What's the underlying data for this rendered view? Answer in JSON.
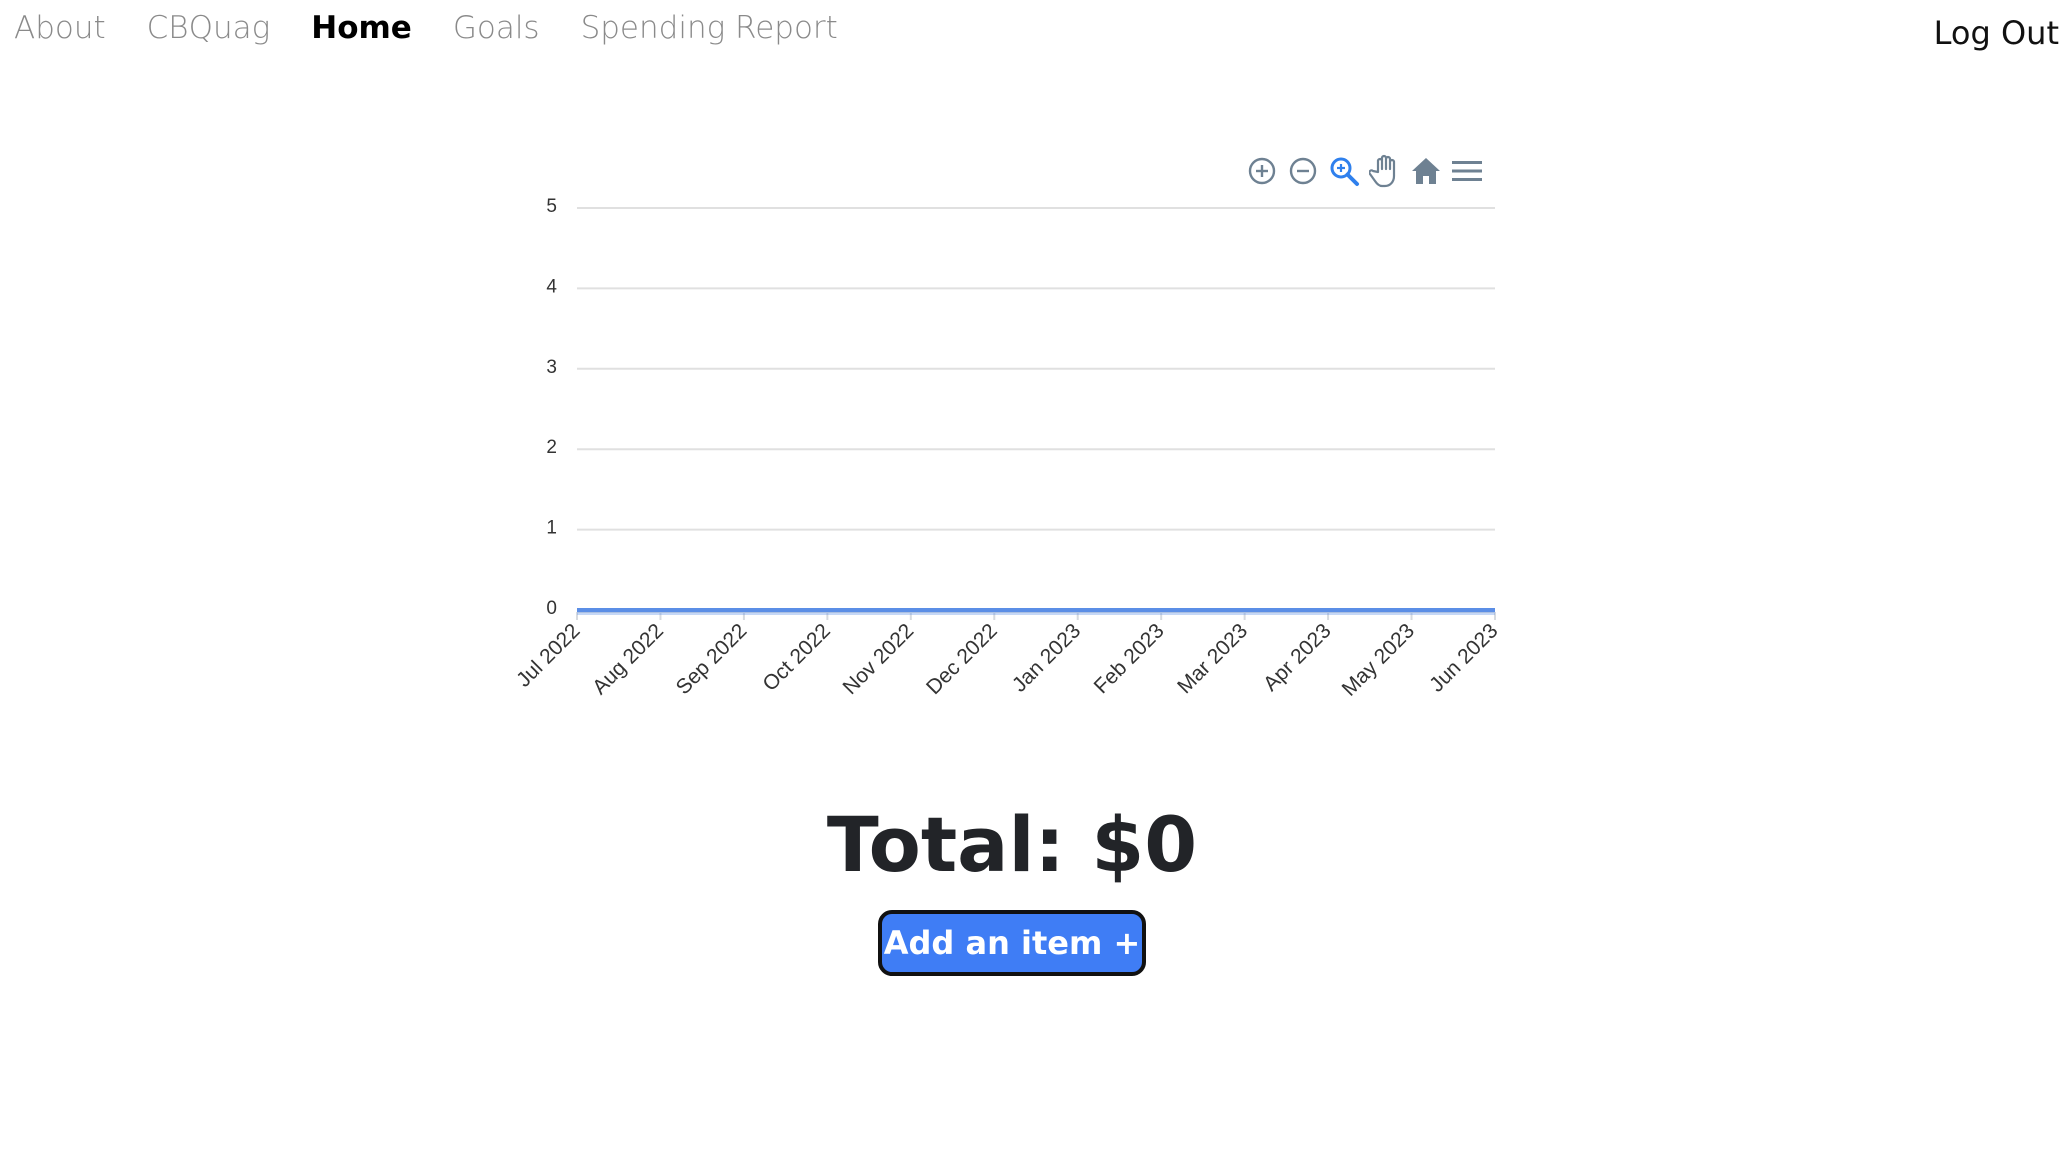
{
  "nav": {
    "links": [
      {
        "label": "About",
        "active": false
      },
      {
        "label": "CBQuag",
        "active": false
      },
      {
        "label": "Home",
        "active": true
      },
      {
        "label": "Goals",
        "active": false
      },
      {
        "label": "Spending Report",
        "active": false
      }
    ],
    "logout_label": "Log Out"
  },
  "chart_toolbar": {
    "icons": [
      "zoom-in-icon",
      "zoom-out-icon",
      "selection-zoom-icon",
      "pan-hand-icon",
      "home-reset-icon",
      "menu-icon"
    ],
    "active_icon": "selection-zoom-icon",
    "accent": "#2f80ed",
    "icon_color": "#6e8192"
  },
  "chart_data": {
    "type": "area",
    "categories": [
      "Jul 2022",
      "Aug 2022",
      "Sep 2022",
      "Oct 2022",
      "Nov 2022",
      "Dec 2022",
      "Jan 2023",
      "Feb 2023",
      "Mar 2023",
      "Apr 2023",
      "May 2023",
      "Jun 2023"
    ],
    "series": [
      {
        "values": [
          0,
          0,
          0,
          0,
          0,
          0,
          0,
          0,
          0,
          0,
          0,
          0
        ],
        "color": "#5b8ee6"
      }
    ],
    "ylim": [
      0,
      5
    ],
    "yticks": [
      "0",
      "1",
      "2",
      "3",
      "4",
      "5"
    ],
    "grid": true,
    "title": "",
    "xlabel": "",
    "ylabel": ""
  },
  "summary": {
    "total_text": "Total: $0"
  },
  "actions": {
    "add_item_label": "Add an item +",
    "button_color": "#3f7df5"
  }
}
